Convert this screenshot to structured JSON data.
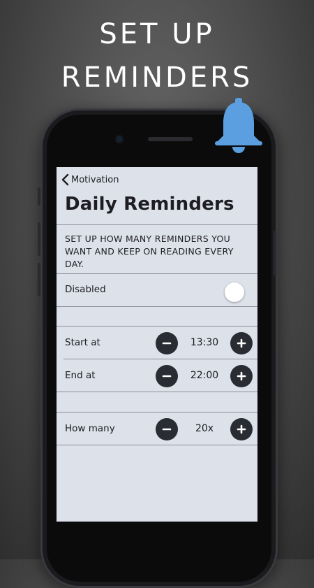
{
  "headline": {
    "line1": "SET UP",
    "line2": "REMINDERS"
  },
  "nav": {
    "back_label": "Motivation"
  },
  "page": {
    "title": "Daily Reminders",
    "description": "SET UP HOW MANY REMINDERS YOU WANT AND KEEP ON READING EVERY DAY."
  },
  "settings": {
    "enabled_label": "Disabled",
    "enabled": false,
    "start": {
      "label": "Start at",
      "value": "13:30"
    },
    "end": {
      "label": "End at",
      "value": "22:00"
    },
    "count": {
      "label": "How many",
      "value": "20x"
    }
  },
  "icons": {
    "back": "chevron-left-icon",
    "minus": "minus-icon",
    "plus": "plus-icon",
    "bell": "bell-icon"
  },
  "colors": {
    "accent_bell": "#5b9fe0",
    "screen_bg": "#dde1ea",
    "button_dark": "#2a2c33",
    "background": "#4a4a4a"
  }
}
